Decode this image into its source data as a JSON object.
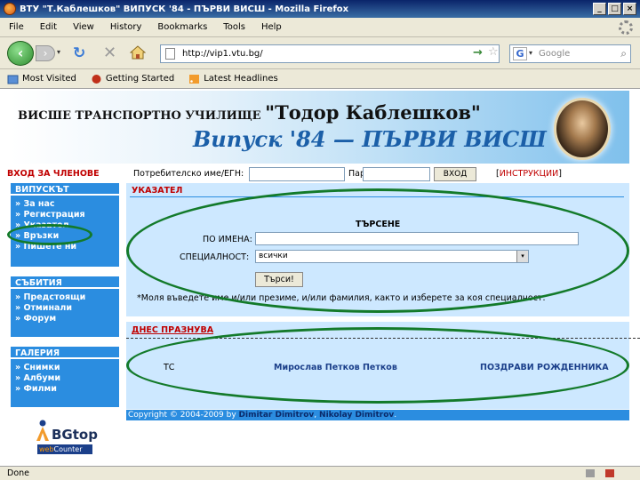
{
  "window": {
    "title": "ВТУ \"Т.Каблешков\" ВИПУСК '84 - ПЪРВИ ВИСШ - Mozilla Firefox",
    "buttons": {
      "minimize": "_",
      "maximize": "□",
      "close": "×"
    }
  },
  "menu": [
    "File",
    "Edit",
    "View",
    "History",
    "Bookmarks",
    "Tools",
    "Help"
  ],
  "nav": {
    "url": "http://vip1.vtu.bg/",
    "search_placeholder": "Google",
    "back_glyph": "‹",
    "forward_glyph": "›",
    "reload_glyph": "↻",
    "stop_glyph": "✕",
    "go_glyph": "→",
    "star_glyph": "☆",
    "search_engine_glyph": "G",
    "dropdown_glyph": "▾",
    "search_glyph": "⌕"
  },
  "bookmarks": [
    "Most Visited",
    "Getting Started",
    "Latest Headlines"
  ],
  "banner": {
    "title_a": "ВИСШЕ ТРАНСПОРТНО УЧИЛИЩЕ ",
    "title_b": "\"Тодор Каблешков\"",
    "subtitle": "Випуск '84 — ПЪРВИ ВИСШ"
  },
  "login": {
    "member_label": "ВХОД ЗА ЧЛЕНОВЕ",
    "user_label": "Потребителско име/ЕГН:",
    "pass_label": "Парола:",
    "login_button": "ВХОД",
    "instr_open": "[",
    "instructions": "ИНСТРУКЦИИ",
    "instr_close": "]"
  },
  "sidebar": [
    {
      "header": "ВИПУСКЪТ",
      "items": [
        "За нас",
        "Регистрация",
        "Указател",
        "Връзки",
        "Пишете ни"
      ]
    },
    {
      "header": "СЪБИТИЯ",
      "items": [
        "Предстоящи",
        "Отминали",
        "Форум"
      ]
    },
    {
      "header": "ГАЛЕРИЯ",
      "items": [
        "Снимки",
        "Албуми",
        "Филми"
      ]
    }
  ],
  "directory": {
    "header": "УКАЗАТЕЛ",
    "search_title": "ТЪРСЕНЕ",
    "name_label": "ПО ИМЕНА:",
    "spec_label": "СПЕЦИАЛНОСТ:",
    "spec_value": "всички",
    "search_button": "Търси!",
    "note": "*Моля въведете име и/или презиме, и/или фамилия, както и изберете за коя специалност."
  },
  "today": {
    "header": "ДНЕС ПРАЗНУВА",
    "specialty": "ТС",
    "name": "Мирослав Петков Петков",
    "action": "ПОЗДРАВИ РОЖДЕННИКА"
  },
  "copyright": {
    "text": "Copyright © 2004-2009 by ",
    "author1": "Dimitar Dimitrov",
    "sep": ", ",
    "author2": "Nikolay Dimitrov",
    "end": "."
  },
  "counter": {
    "brand": "BGtop",
    "web": "web",
    "counter": "Counter"
  },
  "status": "Done",
  "colors": {
    "accent": "#2b8de0",
    "panel": "#cde8ff",
    "red": "#c00000",
    "oval": "#137a2a"
  }
}
